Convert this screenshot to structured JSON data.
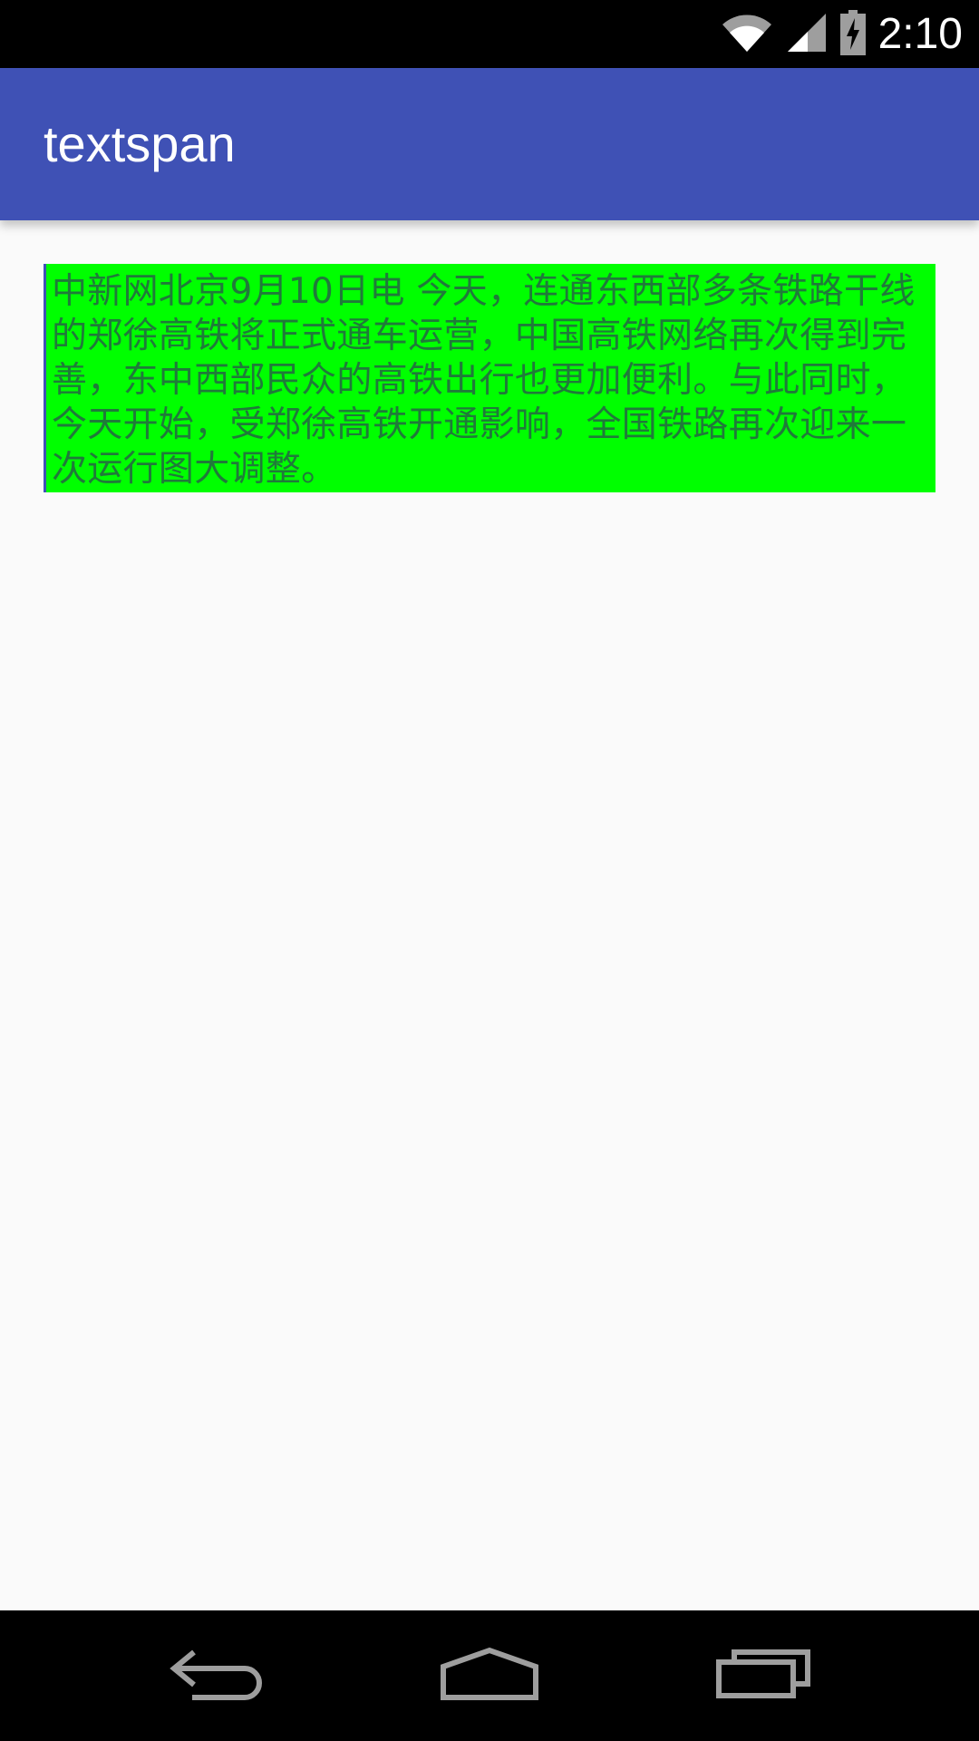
{
  "status_bar": {
    "time": "2:10",
    "icons": [
      "wifi-icon",
      "signal-icon",
      "battery-charging-icon"
    ]
  },
  "app_bar": {
    "title": "textspan"
  },
  "content": {
    "paragraph": "中新网北京9月10日电 今天，连通东西部多条铁路干线的郑徐高铁将正式通车运营，中国高铁网络再次得到完善，东中西部民众的高铁出行也更加便利。与此同时，今天开始，受郑徐高铁开通影响，全国铁路再次迎来一次运行图大调整。",
    "background_color": "#00ff00",
    "text_color": "#207a3a"
  },
  "nav_bar": {
    "buttons": [
      "back-icon",
      "home-icon",
      "recents-icon"
    ]
  },
  "colors": {
    "primary": "#3f51b5",
    "status_bar": "#000000",
    "background": "#fafafa"
  }
}
